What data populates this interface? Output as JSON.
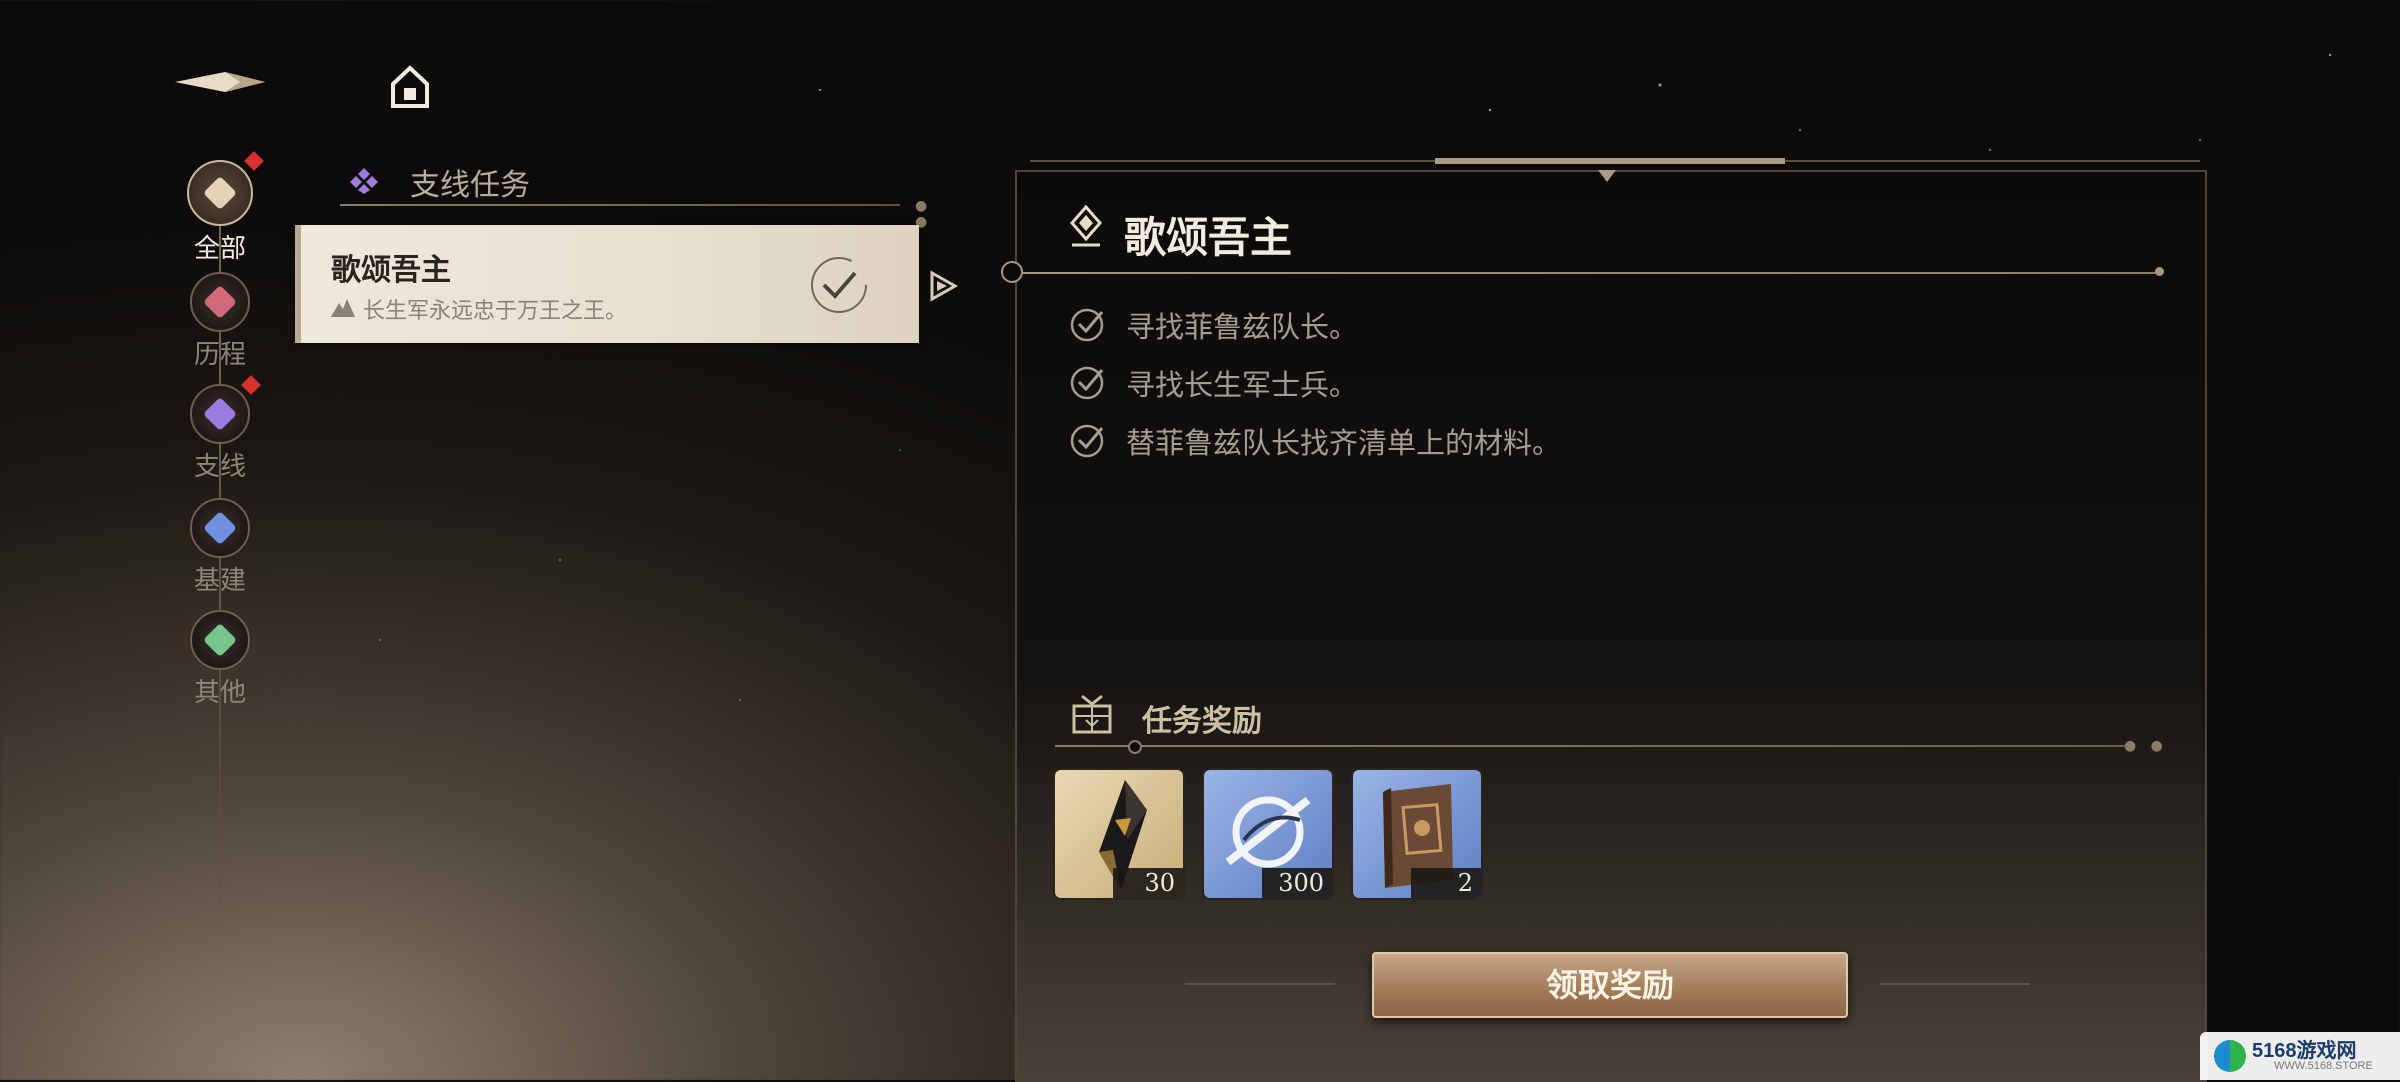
{
  "nav": {
    "back_icon": "back-arrow-icon",
    "home_icon": "home-icon"
  },
  "categories": [
    {
      "label": "全部",
      "icon": "diamond-cluster-icon",
      "color": "#e6d3b5",
      "active": true,
      "badge": true
    },
    {
      "label": "历程",
      "icon": "journey-icon",
      "color": "#d06a7a",
      "active": false,
      "badge": false
    },
    {
      "label": "支线",
      "icon": "side-quest-icon",
      "color": "#9b7be0",
      "active": false,
      "badge": true
    },
    {
      "label": "基建",
      "icon": "base-build-icon",
      "color": "#6e8fe0",
      "active": false,
      "badge": false
    },
    {
      "label": "其他",
      "icon": "other-icon",
      "color": "#79c78f",
      "active": false,
      "badge": false
    }
  ],
  "section": {
    "title": "支线任务",
    "icon": "side-quest-icon"
  },
  "quest_list": [
    {
      "name": "歌颂吾主",
      "subtitle": "长生军永远忠于万王之王。",
      "completed": true
    }
  ],
  "detail": {
    "title": "歌颂吾主",
    "objectives": [
      {
        "text": "寻找菲鲁兹队长。",
        "done": true
      },
      {
        "text": "寻找长生军士兵。",
        "done": true
      },
      {
        "text": "替菲鲁兹队长找齐清单上的材料。",
        "done": true
      }
    ],
    "rewards_title": "任务奖励",
    "rewards": [
      {
        "item": "dark-crystal-shard",
        "count": "30",
        "rarity_color": "#d9c08a"
      },
      {
        "item": "blue-emblem-currency",
        "count": "300",
        "rarity_color": "#6f93d6"
      },
      {
        "item": "leather-book",
        "count": "2",
        "rarity_color": "#6f93d6"
      }
    ],
    "claim_label": "领取奖励"
  },
  "watermark": {
    "text": "5168游戏网",
    "sub": "WWW.5168.STORE"
  }
}
